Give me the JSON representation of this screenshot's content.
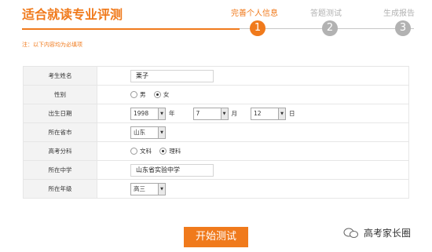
{
  "header": {
    "title": "适合就读专业评测"
  },
  "steps": [
    {
      "label": "完善个人信息",
      "number": "1",
      "state": "active"
    },
    {
      "label": "答题测试",
      "number": "2",
      "state": "inactive"
    },
    {
      "label": "生成报告",
      "number": "3",
      "state": "inactive"
    }
  ],
  "note": "注：以下内容均为必填项",
  "form": {
    "name": {
      "label": "考生姓名",
      "value": "栗子"
    },
    "gender": {
      "label": "性别",
      "options": [
        "男",
        "女"
      ],
      "selected": "女"
    },
    "birth": {
      "label": "出生日期",
      "year": "1998",
      "year_unit": "年",
      "month": "7",
      "month_unit": "月",
      "day": "12",
      "day_unit": "日"
    },
    "province": {
      "label": "所在省市",
      "value": "山东"
    },
    "subject": {
      "label": "高考分科",
      "options": [
        "文科",
        "理科"
      ],
      "selected": "理科"
    },
    "school": {
      "label": "所在中学",
      "value": "山东省实验中学"
    },
    "grade": {
      "label": "所在年级",
      "value": "高三"
    }
  },
  "start_button": "开始测试",
  "watermark": "高考家长圈",
  "colors": {
    "accent": "#f07a1c",
    "inactive": "#b2b2b2"
  }
}
